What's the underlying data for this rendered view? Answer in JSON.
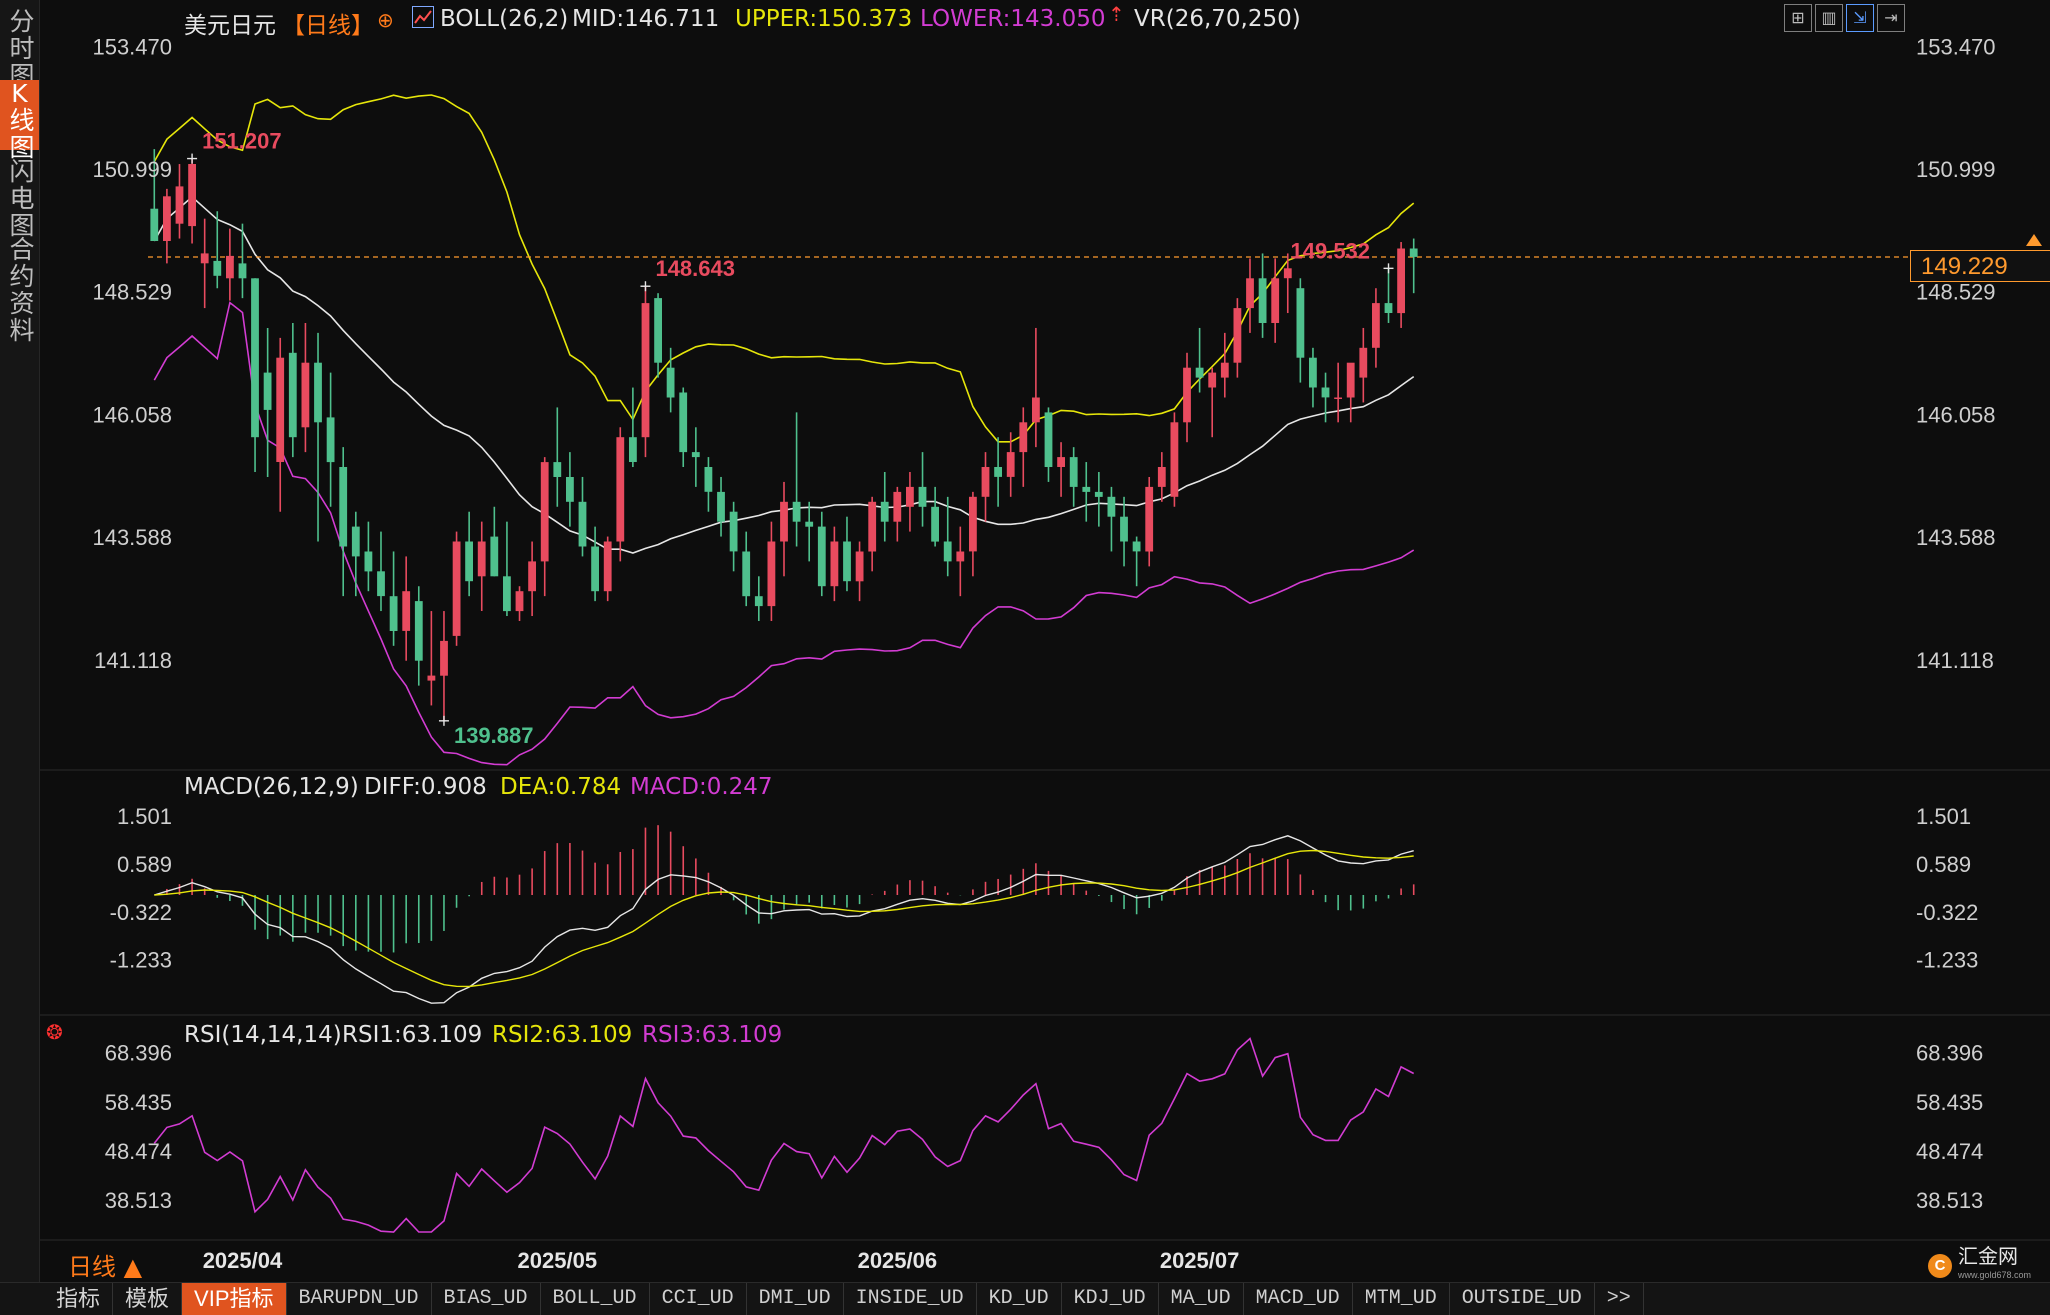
{
  "sidebar": {
    "tabs": [
      {
        "label": "分时图",
        "active": false
      },
      {
        "label": "K线图",
        "active": true
      },
      {
        "label": "闪电图",
        "active": false
      },
      {
        "label": "合约资料",
        "active": false
      }
    ]
  },
  "header": {
    "symbol": "美元日元",
    "period_tag": "【日线】",
    "boll_label": "BOLL(26,2)",
    "mid": "MID:146.711",
    "upper": "UPPER:150.373",
    "lower": "LOWER:143.050",
    "vr_label": "VR(26,70,250)",
    "toolbar_icons": [
      "grid-layout-icon",
      "bar-chart-icon",
      "line-chart-icon",
      "exit-icon"
    ]
  },
  "colors": {
    "up": "#e84b5f",
    "down": "#4fc08d",
    "mid": "#e6e6e6",
    "upper": "#e6e60a",
    "lower": "#d23cd2",
    "diff": "#e6e6e6",
    "dea": "#e6e60a",
    "rsi": "#d23cd2",
    "current_price": "#ff9a2e"
  },
  "main_chart": {
    "y_ticks": [
      "153.470",
      "150.999",
      "148.529",
      "146.058",
      "143.588",
      "141.118"
    ],
    "current_price": "149.229",
    "annotations": [
      {
        "text": "151.207",
        "kind": "high"
      },
      {
        "text": "148.643",
        "kind": "high"
      },
      {
        "text": "149.532",
        "kind": "high"
      },
      {
        "text": "139.887",
        "kind": "low"
      }
    ]
  },
  "macd": {
    "title": "MACD(26,12,9)",
    "diff": "DIFF:0.908",
    "dea": "DEA:0.784",
    "macd": "MACD:0.247",
    "y_ticks": [
      "1.501",
      "0.589",
      "-0.322",
      "-1.233"
    ]
  },
  "rsi": {
    "title": "RSI(14,14,14)",
    "rsi1": "RSI1:63.109",
    "rsi2": "RSI2:63.109",
    "rsi3": "RSI3:63.109",
    "y_ticks": [
      "68.396",
      "58.435",
      "48.474",
      "38.513"
    ]
  },
  "x_axis": {
    "labels": [
      "2025/04",
      "2025/05",
      "2025/06",
      "2025/07"
    ]
  },
  "period_label": "日线 ▲",
  "bottom_bar": {
    "items": [
      "指标",
      "模板",
      "VIP指标",
      "BARUPDN_UD",
      "BIAS_UD",
      "BOLL_UD",
      "CCI_UD",
      "DMI_UD",
      "INSIDE_UD",
      "KD_UD",
      "KDJ_UD",
      "MA_UD",
      "MACD_UD",
      "MTM_UD",
      "OUTSIDE_UD",
      ">>"
    ]
  },
  "brand": {
    "logo_text": "汇金网",
    "logo_sub": "www.gold678.com"
  },
  "chart_data": {
    "type": "candlestick",
    "title": "美元日元【日线】",
    "candles": [
      {
        "o": 150.2,
        "h": 151.4,
        "l": 149.6,
        "c": 149.55
      },
      {
        "o": 149.55,
        "h": 150.6,
        "l": 149.1,
        "c": 150.45
      },
      {
        "o": 149.9,
        "h": 151.1,
        "l": 149.6,
        "c": 150.65
      },
      {
        "o": 149.85,
        "h": 151.21,
        "l": 149.5,
        "c": 151.1
      },
      {
        "o": 149.1,
        "h": 150.0,
        "l": 148.2,
        "c": 149.3
      },
      {
        "o": 149.15,
        "h": 150.15,
        "l": 148.6,
        "c": 148.85
      },
      {
        "o": 148.8,
        "h": 149.8,
        "l": 148.35,
        "c": 149.25
      },
      {
        "o": 149.1,
        "h": 149.9,
        "l": 148.4,
        "c": 148.8
      },
      {
        "o": 148.8,
        "h": 148.8,
        "l": 144.9,
        "c": 145.6
      },
      {
        "o": 146.9,
        "h": 147.8,
        "l": 144.8,
        "c": 146.15
      },
      {
        "o": 145.1,
        "h": 147.6,
        "l": 144.1,
        "c": 147.2
      },
      {
        "o": 147.3,
        "h": 147.9,
        "l": 145.2,
        "c": 145.6
      },
      {
        "o": 145.8,
        "h": 147.9,
        "l": 145.3,
        "c": 147.1
      },
      {
        "o": 147.1,
        "h": 147.7,
        "l": 143.5,
        "c": 145.9
      },
      {
        "o": 146.0,
        "h": 146.9,
        "l": 144.2,
        "c": 145.1
      },
      {
        "o": 145.0,
        "h": 145.4,
        "l": 142.4,
        "c": 143.4
      },
      {
        "o": 143.8,
        "h": 144.1,
        "l": 142.4,
        "c": 143.2
      },
      {
        "o": 143.3,
        "h": 143.9,
        "l": 142.5,
        "c": 142.9
      },
      {
        "o": 142.9,
        "h": 143.7,
        "l": 142.1,
        "c": 142.4
      },
      {
        "o": 142.4,
        "h": 143.3,
        "l": 141.4,
        "c": 141.7
      },
      {
        "o": 141.7,
        "h": 143.2,
        "l": 141.1,
        "c": 142.5
      },
      {
        "o": 142.3,
        "h": 142.6,
        "l": 140.6,
        "c": 141.1
      },
      {
        "o": 140.7,
        "h": 142.1,
        "l": 140.2,
        "c": 140.8
      },
      {
        "o": 140.8,
        "h": 142.1,
        "l": 139.89,
        "c": 141.5
      },
      {
        "o": 141.6,
        "h": 143.7,
        "l": 141.4,
        "c": 143.5
      },
      {
        "o": 143.5,
        "h": 144.1,
        "l": 142.4,
        "c": 142.7
      },
      {
        "o": 142.8,
        "h": 143.9,
        "l": 142.1,
        "c": 143.5
      },
      {
        "o": 143.6,
        "h": 144.2,
        "l": 142.8,
        "c": 142.8
      },
      {
        "o": 142.8,
        "h": 143.9,
        "l": 142.0,
        "c": 142.1
      },
      {
        "o": 142.1,
        "h": 142.6,
        "l": 141.9,
        "c": 142.5
      },
      {
        "o": 142.5,
        "h": 143.5,
        "l": 142.0,
        "c": 143.1
      },
      {
        "o": 143.1,
        "h": 145.2,
        "l": 142.4,
        "c": 145.1
      },
      {
        "o": 145.1,
        "h": 146.2,
        "l": 144.2,
        "c": 144.8
      },
      {
        "o": 144.8,
        "h": 145.3,
        "l": 143.8,
        "c": 144.3
      },
      {
        "o": 144.3,
        "h": 144.8,
        "l": 143.2,
        "c": 143.4
      },
      {
        "o": 143.4,
        "h": 143.8,
        "l": 142.3,
        "c": 142.5
      },
      {
        "o": 142.5,
        "h": 143.6,
        "l": 142.3,
        "c": 143.5
      },
      {
        "o": 143.5,
        "h": 145.8,
        "l": 143.1,
        "c": 145.6
      },
      {
        "o": 145.6,
        "h": 146.6,
        "l": 145.0,
        "c": 145.1
      },
      {
        "o": 145.6,
        "h": 148.64,
        "l": 145.2,
        "c": 148.3
      },
      {
        "o": 148.4,
        "h": 148.5,
        "l": 146.8,
        "c": 147.1
      },
      {
        "o": 147.0,
        "h": 147.4,
        "l": 146.1,
        "c": 146.4
      },
      {
        "o": 146.5,
        "h": 146.6,
        "l": 145.0,
        "c": 145.3
      },
      {
        "o": 145.3,
        "h": 145.8,
        "l": 144.6,
        "c": 145.2
      },
      {
        "o": 145.0,
        "h": 145.2,
        "l": 144.1,
        "c": 144.5
      },
      {
        "o": 144.5,
        "h": 144.8,
        "l": 143.6,
        "c": 143.9
      },
      {
        "o": 144.1,
        "h": 144.3,
        "l": 142.9,
        "c": 143.3
      },
      {
        "o": 143.3,
        "h": 143.7,
        "l": 142.2,
        "c": 142.4
      },
      {
        "o": 142.4,
        "h": 142.8,
        "l": 141.9,
        "c": 142.2
      },
      {
        "o": 142.2,
        "h": 143.9,
        "l": 141.9,
        "c": 143.5
      },
      {
        "o": 143.5,
        "h": 144.7,
        "l": 142.8,
        "c": 144.3
      },
      {
        "o": 144.3,
        "h": 146.1,
        "l": 143.4,
        "c": 143.9
      },
      {
        "o": 143.9,
        "h": 144.3,
        "l": 143.1,
        "c": 143.8
      },
      {
        "o": 143.8,
        "h": 144.1,
        "l": 142.4,
        "c": 142.6
      },
      {
        "o": 142.6,
        "h": 143.8,
        "l": 142.3,
        "c": 143.5
      },
      {
        "o": 143.5,
        "h": 144.0,
        "l": 142.5,
        "c": 142.7
      },
      {
        "o": 142.7,
        "h": 143.5,
        "l": 142.3,
        "c": 143.3
      },
      {
        "o": 143.3,
        "h": 144.4,
        "l": 142.9,
        "c": 144.3
      },
      {
        "o": 144.3,
        "h": 144.9,
        "l": 143.5,
        "c": 143.9
      },
      {
        "o": 143.9,
        "h": 144.6,
        "l": 143.5,
        "c": 144.5
      },
      {
        "o": 144.2,
        "h": 144.9,
        "l": 143.7,
        "c": 144.6
      },
      {
        "o": 144.6,
        "h": 145.3,
        "l": 143.8,
        "c": 144.2
      },
      {
        "o": 144.2,
        "h": 144.6,
        "l": 143.4,
        "c": 143.5
      },
      {
        "o": 143.5,
        "h": 144.4,
        "l": 142.8,
        "c": 143.1
      },
      {
        "o": 143.1,
        "h": 143.8,
        "l": 142.4,
        "c": 143.3
      },
      {
        "o": 143.3,
        "h": 144.5,
        "l": 142.8,
        "c": 144.4
      },
      {
        "o": 144.4,
        "h": 145.3,
        "l": 143.9,
        "c": 145.0
      },
      {
        "o": 145.0,
        "h": 145.6,
        "l": 144.2,
        "c": 144.8
      },
      {
        "o": 144.8,
        "h": 145.7,
        "l": 144.4,
        "c": 145.3
      },
      {
        "o": 145.3,
        "h": 146.2,
        "l": 144.6,
        "c": 145.9
      },
      {
        "o": 145.9,
        "h": 147.8,
        "l": 145.4,
        "c": 146.4
      },
      {
        "o": 146.1,
        "h": 146.2,
        "l": 144.7,
        "c": 145.0
      },
      {
        "o": 145.0,
        "h": 145.5,
        "l": 144.4,
        "c": 145.2
      },
      {
        "o": 145.2,
        "h": 145.4,
        "l": 144.2,
        "c": 144.6
      },
      {
        "o": 144.6,
        "h": 145.1,
        "l": 143.9,
        "c": 144.5
      },
      {
        "o": 144.5,
        "h": 144.9,
        "l": 143.8,
        "c": 144.4
      },
      {
        "o": 144.4,
        "h": 144.6,
        "l": 143.3,
        "c": 144.0
      },
      {
        "o": 144.0,
        "h": 144.4,
        "l": 143.0,
        "c": 143.5
      },
      {
        "o": 143.5,
        "h": 143.6,
        "l": 142.6,
        "c": 143.3
      },
      {
        "o": 143.3,
        "h": 144.8,
        "l": 143.0,
        "c": 144.6
      },
      {
        "o": 144.6,
        "h": 145.3,
        "l": 144.3,
        "c": 145.0
      },
      {
        "o": 144.4,
        "h": 146.1,
        "l": 144.2,
        "c": 145.9
      },
      {
        "o": 145.9,
        "h": 147.3,
        "l": 145.5,
        "c": 147.0
      },
      {
        "o": 147.0,
        "h": 147.8,
        "l": 146.5,
        "c": 146.8
      },
      {
        "o": 146.6,
        "h": 147.0,
        "l": 145.6,
        "c": 146.9
      },
      {
        "o": 146.8,
        "h": 147.7,
        "l": 146.4,
        "c": 147.1
      },
      {
        "o": 147.1,
        "h": 148.4,
        "l": 146.8,
        "c": 148.2
      },
      {
        "o": 148.2,
        "h": 149.2,
        "l": 147.7,
        "c": 148.8
      },
      {
        "o": 148.8,
        "h": 149.3,
        "l": 147.6,
        "c": 147.9
      },
      {
        "o": 147.9,
        "h": 149.2,
        "l": 147.5,
        "c": 148.8
      },
      {
        "o": 148.8,
        "h": 149.3,
        "l": 148.1,
        "c": 149.0
      },
      {
        "o": 148.6,
        "h": 148.8,
        "l": 146.7,
        "c": 147.2
      },
      {
        "o": 147.2,
        "h": 147.4,
        "l": 146.2,
        "c": 146.6
      },
      {
        "o": 146.6,
        "h": 146.9,
        "l": 145.9,
        "c": 146.4
      },
      {
        "o": 146.4,
        "h": 147.1,
        "l": 145.9,
        "c": 146.4
      },
      {
        "o": 146.4,
        "h": 146.9,
        "l": 145.9,
        "c": 147.1
      },
      {
        "o": 146.8,
        "h": 147.8,
        "l": 146.3,
        "c": 147.4
      },
      {
        "o": 147.4,
        "h": 148.6,
        "l": 147.0,
        "c": 148.3
      },
      {
        "o": 148.3,
        "h": 149.0,
        "l": 147.9,
        "c": 148.1
      },
      {
        "o": 148.1,
        "h": 149.53,
        "l": 147.8,
        "c": 149.4
      },
      {
        "o": 149.4,
        "h": 149.6,
        "l": 148.5,
        "c": 149.23
      }
    ],
    "x_labels": [
      "2025/04",
      "2025/05",
      "2025/06",
      "2025/07"
    ],
    "y_ticks": [
      153.47,
      150.999,
      148.529,
      146.058,
      143.588,
      141.118
    ],
    "ylim": [
      138.9,
      154.0
    ],
    "macd": {
      "ylim": [
        -2.0,
        2.0
      ],
      "ticks": [
        1.501,
        0.589,
        -0.322,
        -1.233
      ]
    },
    "rsi": {
      "ylim": [
        32.0,
        72.0
      ],
      "ticks": [
        68.396,
        58.435,
        48.474,
        38.513
      ]
    },
    "grid": false
  }
}
